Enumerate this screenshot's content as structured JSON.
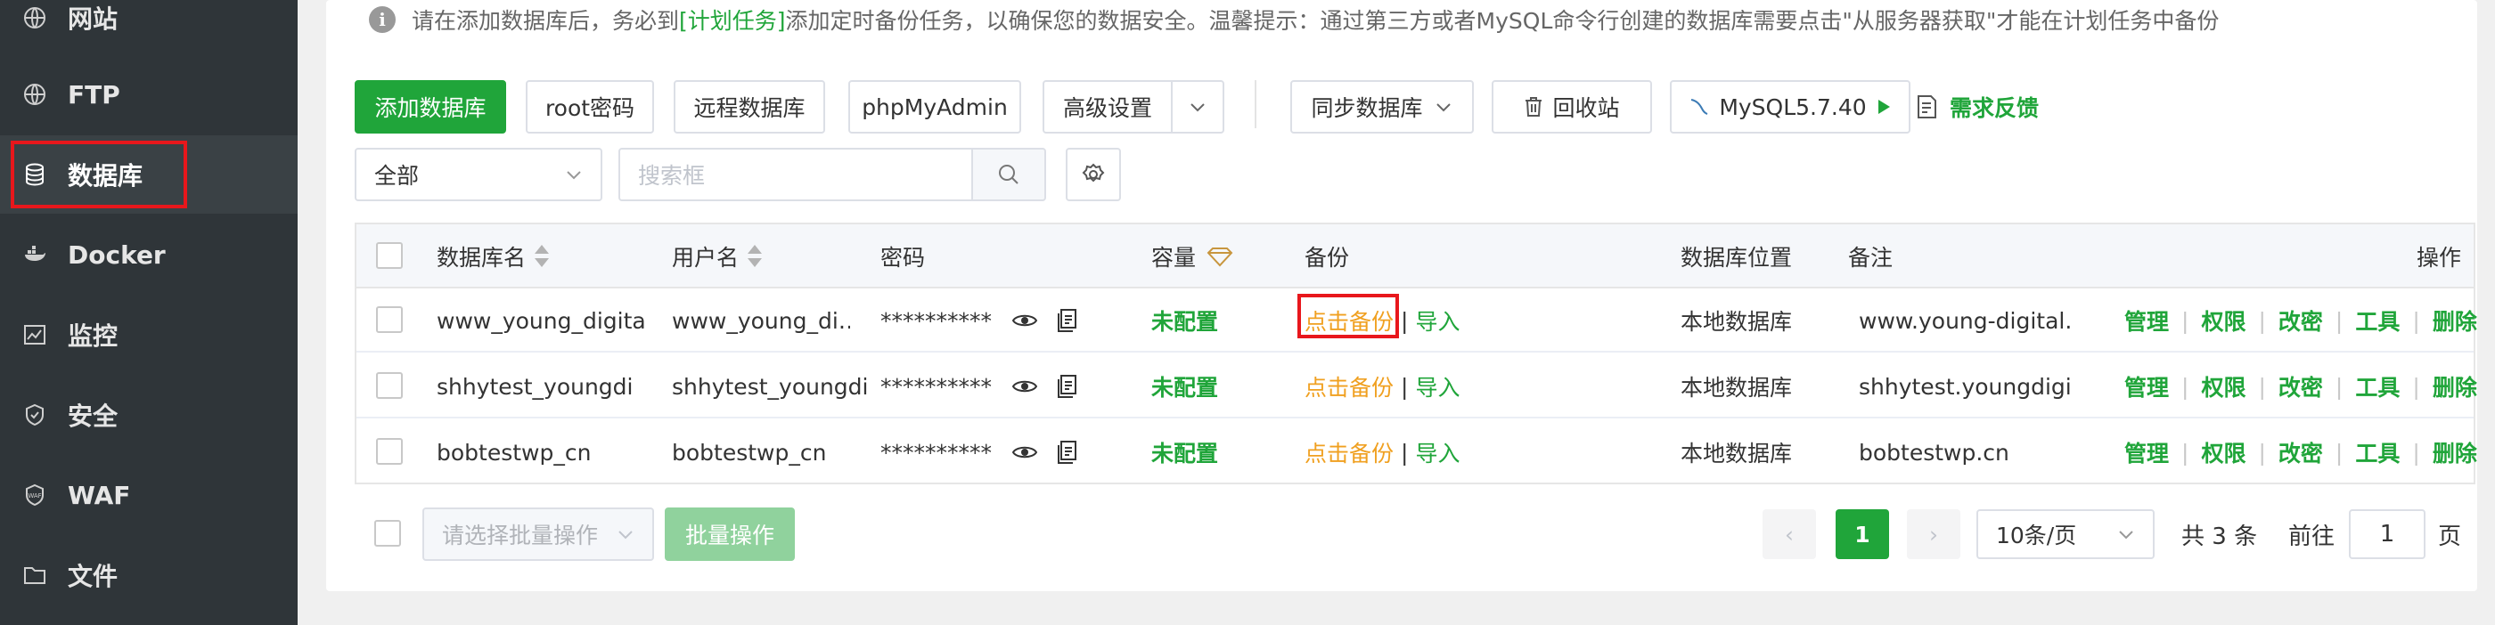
{
  "sidebar": {
    "items": [
      {
        "label": "网站",
        "icon": "globe-icon"
      },
      {
        "label": "FTP",
        "icon": "ftp-globe-icon"
      },
      {
        "label": "数据库",
        "icon": "database-icon",
        "active": true
      },
      {
        "label": "Docker",
        "icon": "docker-icon"
      },
      {
        "label": "监控",
        "icon": "monitor-chart-icon"
      },
      {
        "label": "安全",
        "icon": "shield-icon"
      },
      {
        "label": "WAF",
        "icon": "waf-shield-icon"
      },
      {
        "label": "文件",
        "icon": "folder-icon"
      }
    ]
  },
  "notice": {
    "before": "请在添加数据库后，务必到",
    "link": "[计划任务]",
    "after": "添加定时备份任务，以确保您的数据安全。温馨提示：通过第三方或者MySQL命令行创建的数据库需要点击\"从服务器获取\"才能在计划任务中备份"
  },
  "toolbar": {
    "add_db": "添加数据库",
    "root_pwd": "root密码",
    "remote_db": "远程数据库",
    "phpmyadmin": "phpMyAdmin",
    "advanced": "高级设置",
    "sync_db": "同步数据库",
    "recycle": "回收站",
    "mysql_version": "MySQL5.7.40",
    "feedback": "需求反馈"
  },
  "filter": {
    "scope": "全部",
    "search_placeholder": "搜索框"
  },
  "table": {
    "headers": {
      "name": "数据库名",
      "user": "用户名",
      "password": "密码",
      "capacity": "容量",
      "backup": "备份",
      "location": "数据库位置",
      "remark": "备注",
      "ops": "操作"
    },
    "rows": [
      {
        "name": "www_young_digita",
        "user": "www_young_di…",
        "password": "**********",
        "capacity": "未配置",
        "backup": "点击备份",
        "import": "导入",
        "location": "本地数据库",
        "remark": "www.young-digital.cr"
      },
      {
        "name": "shhytest_youngdi",
        "user": "shhytest_youngdi",
        "password": "**********",
        "capacity": "未配置",
        "backup": "点击备份",
        "import": "导入",
        "location": "本地数据库",
        "remark": "shhytest.youngdigital"
      },
      {
        "name": "bobtestwp_cn",
        "user": "bobtestwp_cn",
        "password": "**********",
        "capacity": "未配置",
        "backup": "点击备份",
        "import": "导入",
        "location": "本地数据库",
        "remark": "bobtestwp.cn"
      }
    ],
    "ops": [
      "管理",
      "权限",
      "改密",
      "工具",
      "删除"
    ],
    "backup_sep": "|"
  },
  "footer": {
    "batch_placeholder": "请选择批量操作",
    "batch_button": "批量操作",
    "prev": "‹",
    "page": "1",
    "next": "›",
    "page_size": "10条/页",
    "total": "共 3 条",
    "goto": "前往",
    "goto_value": "1",
    "page_suffix": "页"
  },
  "colors": {
    "accent": "#20a53a",
    "backup_link": "#f0a020",
    "highlight": "#e8171c",
    "sidebar_bg": "#2f3539"
  }
}
